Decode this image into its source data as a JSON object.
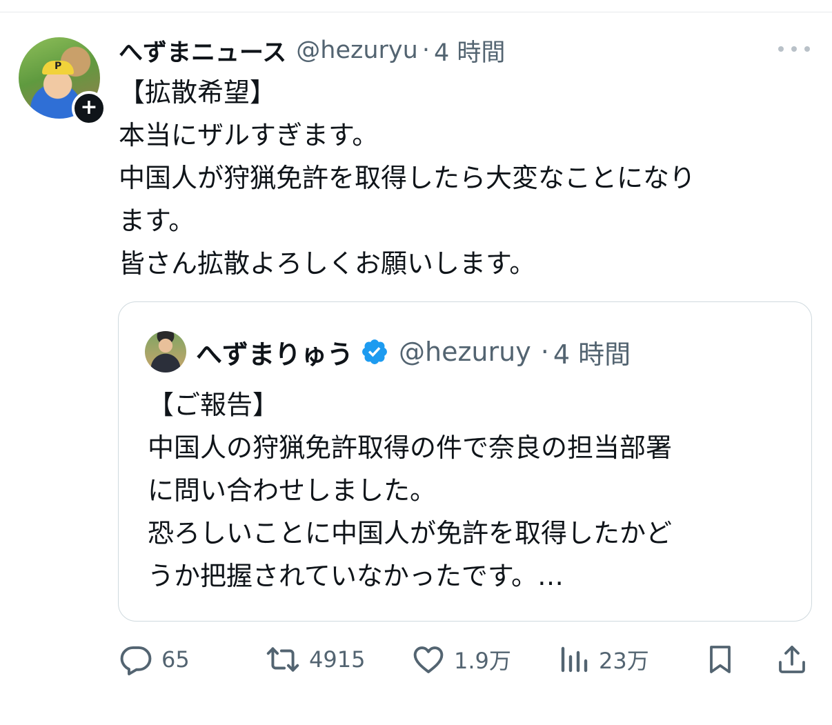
{
  "post": {
    "display_name": "へずまニュース",
    "handle": "@hezuryu",
    "separator": "·",
    "time": "4 時間",
    "avatar_cap_letter": "P",
    "follow_symbol": "+",
    "text_lines": [
      "【拡散希望】",
      "本当にザルすぎます。",
      "中国人が狩猟免許を取得したら大変なことになり",
      "ます。",
      "皆さん拡散よろしくお願いします。"
    ]
  },
  "quote": {
    "display_name": "へずまりゅう",
    "handle": "@hezuruy",
    "separator": "·",
    "time": "4 時間",
    "verified": true,
    "text_lines": [
      "【ご報告】",
      "中国人の狩猟免許取得の件で奈良の担当部署",
      "に問い合わせしました。",
      "恐ろしいことに中国人が免許を取得したかど",
      "うか把握されていなかったです。…"
    ]
  },
  "actions": {
    "replies": "65",
    "reposts": "4915",
    "likes": "1.9万",
    "views": "23万"
  },
  "icons": {
    "reply": "reply-icon",
    "repost": "repost-icon",
    "like": "like-icon",
    "views": "views-icon",
    "bookmark": "bookmark-icon",
    "share": "share-icon",
    "more": "more-icon",
    "verified": "verified-badge-icon"
  },
  "colors": {
    "text": "#0f1419",
    "secondary": "#536471",
    "border": "#cfd9de",
    "verified": "#1d9bf0"
  }
}
